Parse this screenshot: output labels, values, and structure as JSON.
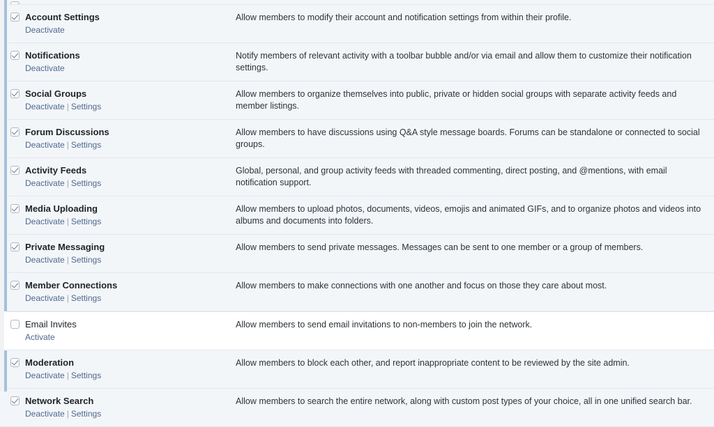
{
  "panel": {
    "accent_color": "#a6c0dd",
    "row_active_bg": "#f3f6f9",
    "row_inactive_bg": "#ffffff",
    "link_color": "#50688f",
    "separator": "|"
  },
  "components": [
    {
      "name": "",
      "description": "",
      "active": true,
      "clipped": true,
      "actions": []
    },
    {
      "name": "Account Settings",
      "description": "Allow members to modify their account and notification settings from within their profile.",
      "active": true,
      "clipped": false,
      "actions": [
        "Deactivate"
      ]
    },
    {
      "name": "Notifications",
      "description": "Notify members of relevant activity with a toolbar bubble and/or via email and allow them to customize their notification settings.",
      "active": true,
      "clipped": false,
      "actions": [
        "Deactivate"
      ]
    },
    {
      "name": "Social Groups",
      "description": "Allow members to organize themselves into public, private or hidden social groups with separate activity feeds and member listings.",
      "active": true,
      "clipped": false,
      "actions": [
        "Deactivate",
        "Settings"
      ]
    },
    {
      "name": "Forum Discussions",
      "description": "Allow members to have discussions using Q&A style message boards. Forums can be standalone or connected to social groups.",
      "active": true,
      "clipped": false,
      "actions": [
        "Deactivate",
        "Settings"
      ]
    },
    {
      "name": "Activity Feeds",
      "description": "Global, personal, and group activity feeds with threaded commenting, direct posting, and @mentions, with email notification support.",
      "active": true,
      "clipped": false,
      "actions": [
        "Deactivate",
        "Settings"
      ]
    },
    {
      "name": "Media Uploading",
      "description": "Allow members to upload photos, documents, videos, emojis and animated GIFs, and to organize photos and videos into albums and documents into folders.",
      "active": true,
      "clipped": false,
      "actions": [
        "Deactivate",
        "Settings"
      ]
    },
    {
      "name": "Private Messaging",
      "description": "Allow members to send private messages. Messages can be sent to one member or a group of members.",
      "active": true,
      "clipped": false,
      "actions": [
        "Deactivate",
        "Settings"
      ]
    },
    {
      "name": "Member Connections",
      "description": "Allow members to make connections with one another and focus on those they care about most.",
      "active": true,
      "clipped": false,
      "actions": [
        "Deactivate",
        "Settings"
      ]
    },
    {
      "name": "Email Invites",
      "description": "Allow members to send email invitations to non-members to join the network.",
      "active": false,
      "clipped": false,
      "actions": [
        "Activate"
      ]
    },
    {
      "name": "Moderation",
      "description": "Allow members to block each other, and report inappropriate content to be reviewed by the site admin.",
      "active": true,
      "clipped": false,
      "actions": [
        "Deactivate",
        "Settings"
      ]
    },
    {
      "name": "Network Search",
      "description": "Allow members to search the entire network, along with custom post types of your choice, all in one unified search bar.",
      "active": true,
      "clipped": false,
      "actions": [
        "Deactivate",
        "Settings"
      ]
    }
  ]
}
